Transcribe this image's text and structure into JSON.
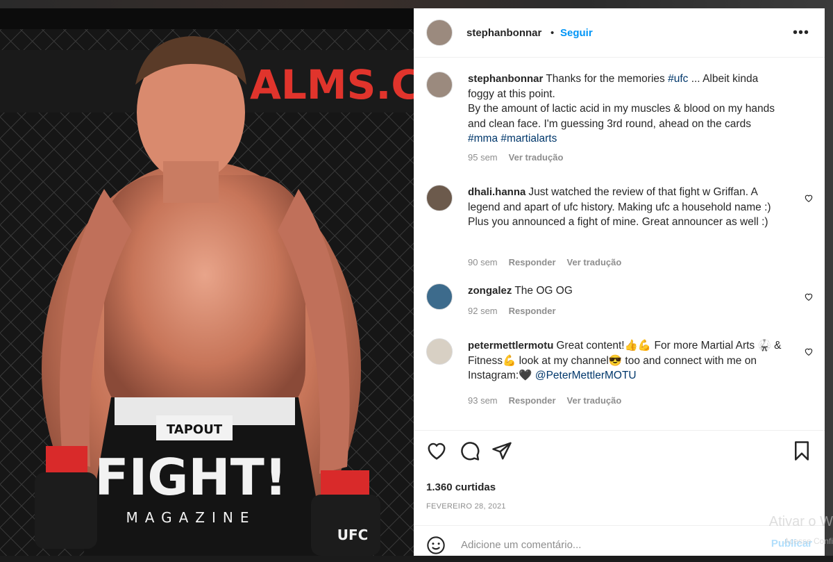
{
  "post": {
    "username": "stephanbonnar",
    "follow_label": "Seguir",
    "more_icon": "more-options-icon",
    "caption": {
      "text1": "Thanks for the memories ",
      "tag1": "#ufc",
      "text2": " ... Albeit kinda foggy at this point.",
      "line2": "By the amount of lactic acid in my muscles & blood on my hands and clean face. I'm guessing 3rd round, ahead on the cards",
      "tags": "#mma #martialarts",
      "time": "95 sem",
      "translate": "Ver tradução"
    },
    "likes": "1.360 curtidas",
    "date": "FEVEREIRO 28, 2021"
  },
  "comments": [
    {
      "username": "dhali.hanna",
      "text": "Just watched the review of that fight w Griffan. A legend and apart of ufc history. Making ufc a household name :) Plus you announced a fight of mine. Great announcer as well :)",
      "time": "90 sem",
      "reply": "Responder",
      "translate": "Ver tradução"
    },
    {
      "username": "zongalez",
      "text": "The OG OG",
      "time": "92 sem",
      "reply": "Responder"
    },
    {
      "username": "petermettlermotu",
      "text_a": "Great content!👍💪 For more Martial Arts 🥋 & Fitness💪 look at my channel😎 too and connect with me on Instagram:🖤 ",
      "mention": "@PeterMettlerMOTU",
      "time": "93 sem",
      "reply": "Responder",
      "translate": "Ver tradução"
    }
  ],
  "add_comment": {
    "placeholder": "Adicione um comentário...",
    "publish": "Publicar"
  },
  "photo": {
    "banner_text": "ALMS.C",
    "brand_text": "TAPOUT",
    "shorts_text": "FIGHT!",
    "shorts_sub": "MAGAZINE",
    "glove_text": "UFC"
  },
  "os_watermark": {
    "line1": "Ativar o W",
    "line2": "Acesse Confi"
  },
  "colors": {
    "link": "#0095f6",
    "hashtag": "#00376b",
    "muted": "#8e8e8e"
  }
}
